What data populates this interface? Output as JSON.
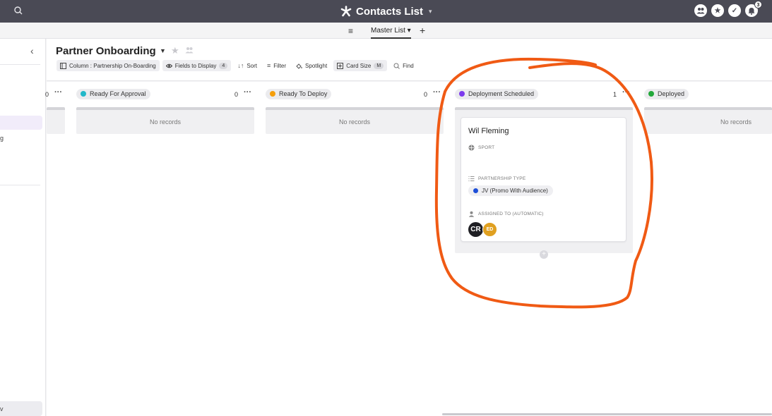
{
  "app": {
    "title": "Contacts List",
    "notification_count": "3"
  },
  "subbar": {
    "view_label": "Master List",
    "add_label": "+"
  },
  "sidebar": {
    "partial_item": "g",
    "bottom_partial": "v"
  },
  "page": {
    "title": "Partner Onboarding"
  },
  "toolbar": {
    "column_label": "Column : Partnership On-Boarding",
    "fields_label": "Fields to Display",
    "fields_count": "4",
    "sort_label": "Sort",
    "filter_label": "Filter",
    "spotlight_label": "Spotlight",
    "card_size_label": "Card Size",
    "card_size_value": "M",
    "find_label": "Find"
  },
  "columns": [
    {
      "name": "",
      "count": "0",
      "color": "#9ca3af"
    },
    {
      "name": "Ready For Approval",
      "count": "0",
      "color": "#22b8c9",
      "empty_text": "No records"
    },
    {
      "name": "Ready To Deploy",
      "count": "0",
      "color": "#f59e0b",
      "empty_text": "No records"
    },
    {
      "name": "Deployment Scheduled",
      "count": "1",
      "color": "#7c3aed"
    },
    {
      "name": "Deployed",
      "count": "",
      "color": "#22a83a",
      "empty_text": "No records"
    }
  ],
  "card": {
    "name": "Wil Fleming",
    "sport_label": "SPORT",
    "partnership_label": "PARTNERSHIP TYPE",
    "partnership_value": "JV (Promo With Audience)",
    "partnership_color": "#1d4ed8",
    "assigned_label": "ASSIGNED TO (AUTOMATIC)",
    "assignees": [
      {
        "initials": "CR",
        "color": "#1f1f24"
      },
      {
        "initials": "ED",
        "color": "#e0a020"
      }
    ]
  },
  "annotation_color": "#f05a14"
}
